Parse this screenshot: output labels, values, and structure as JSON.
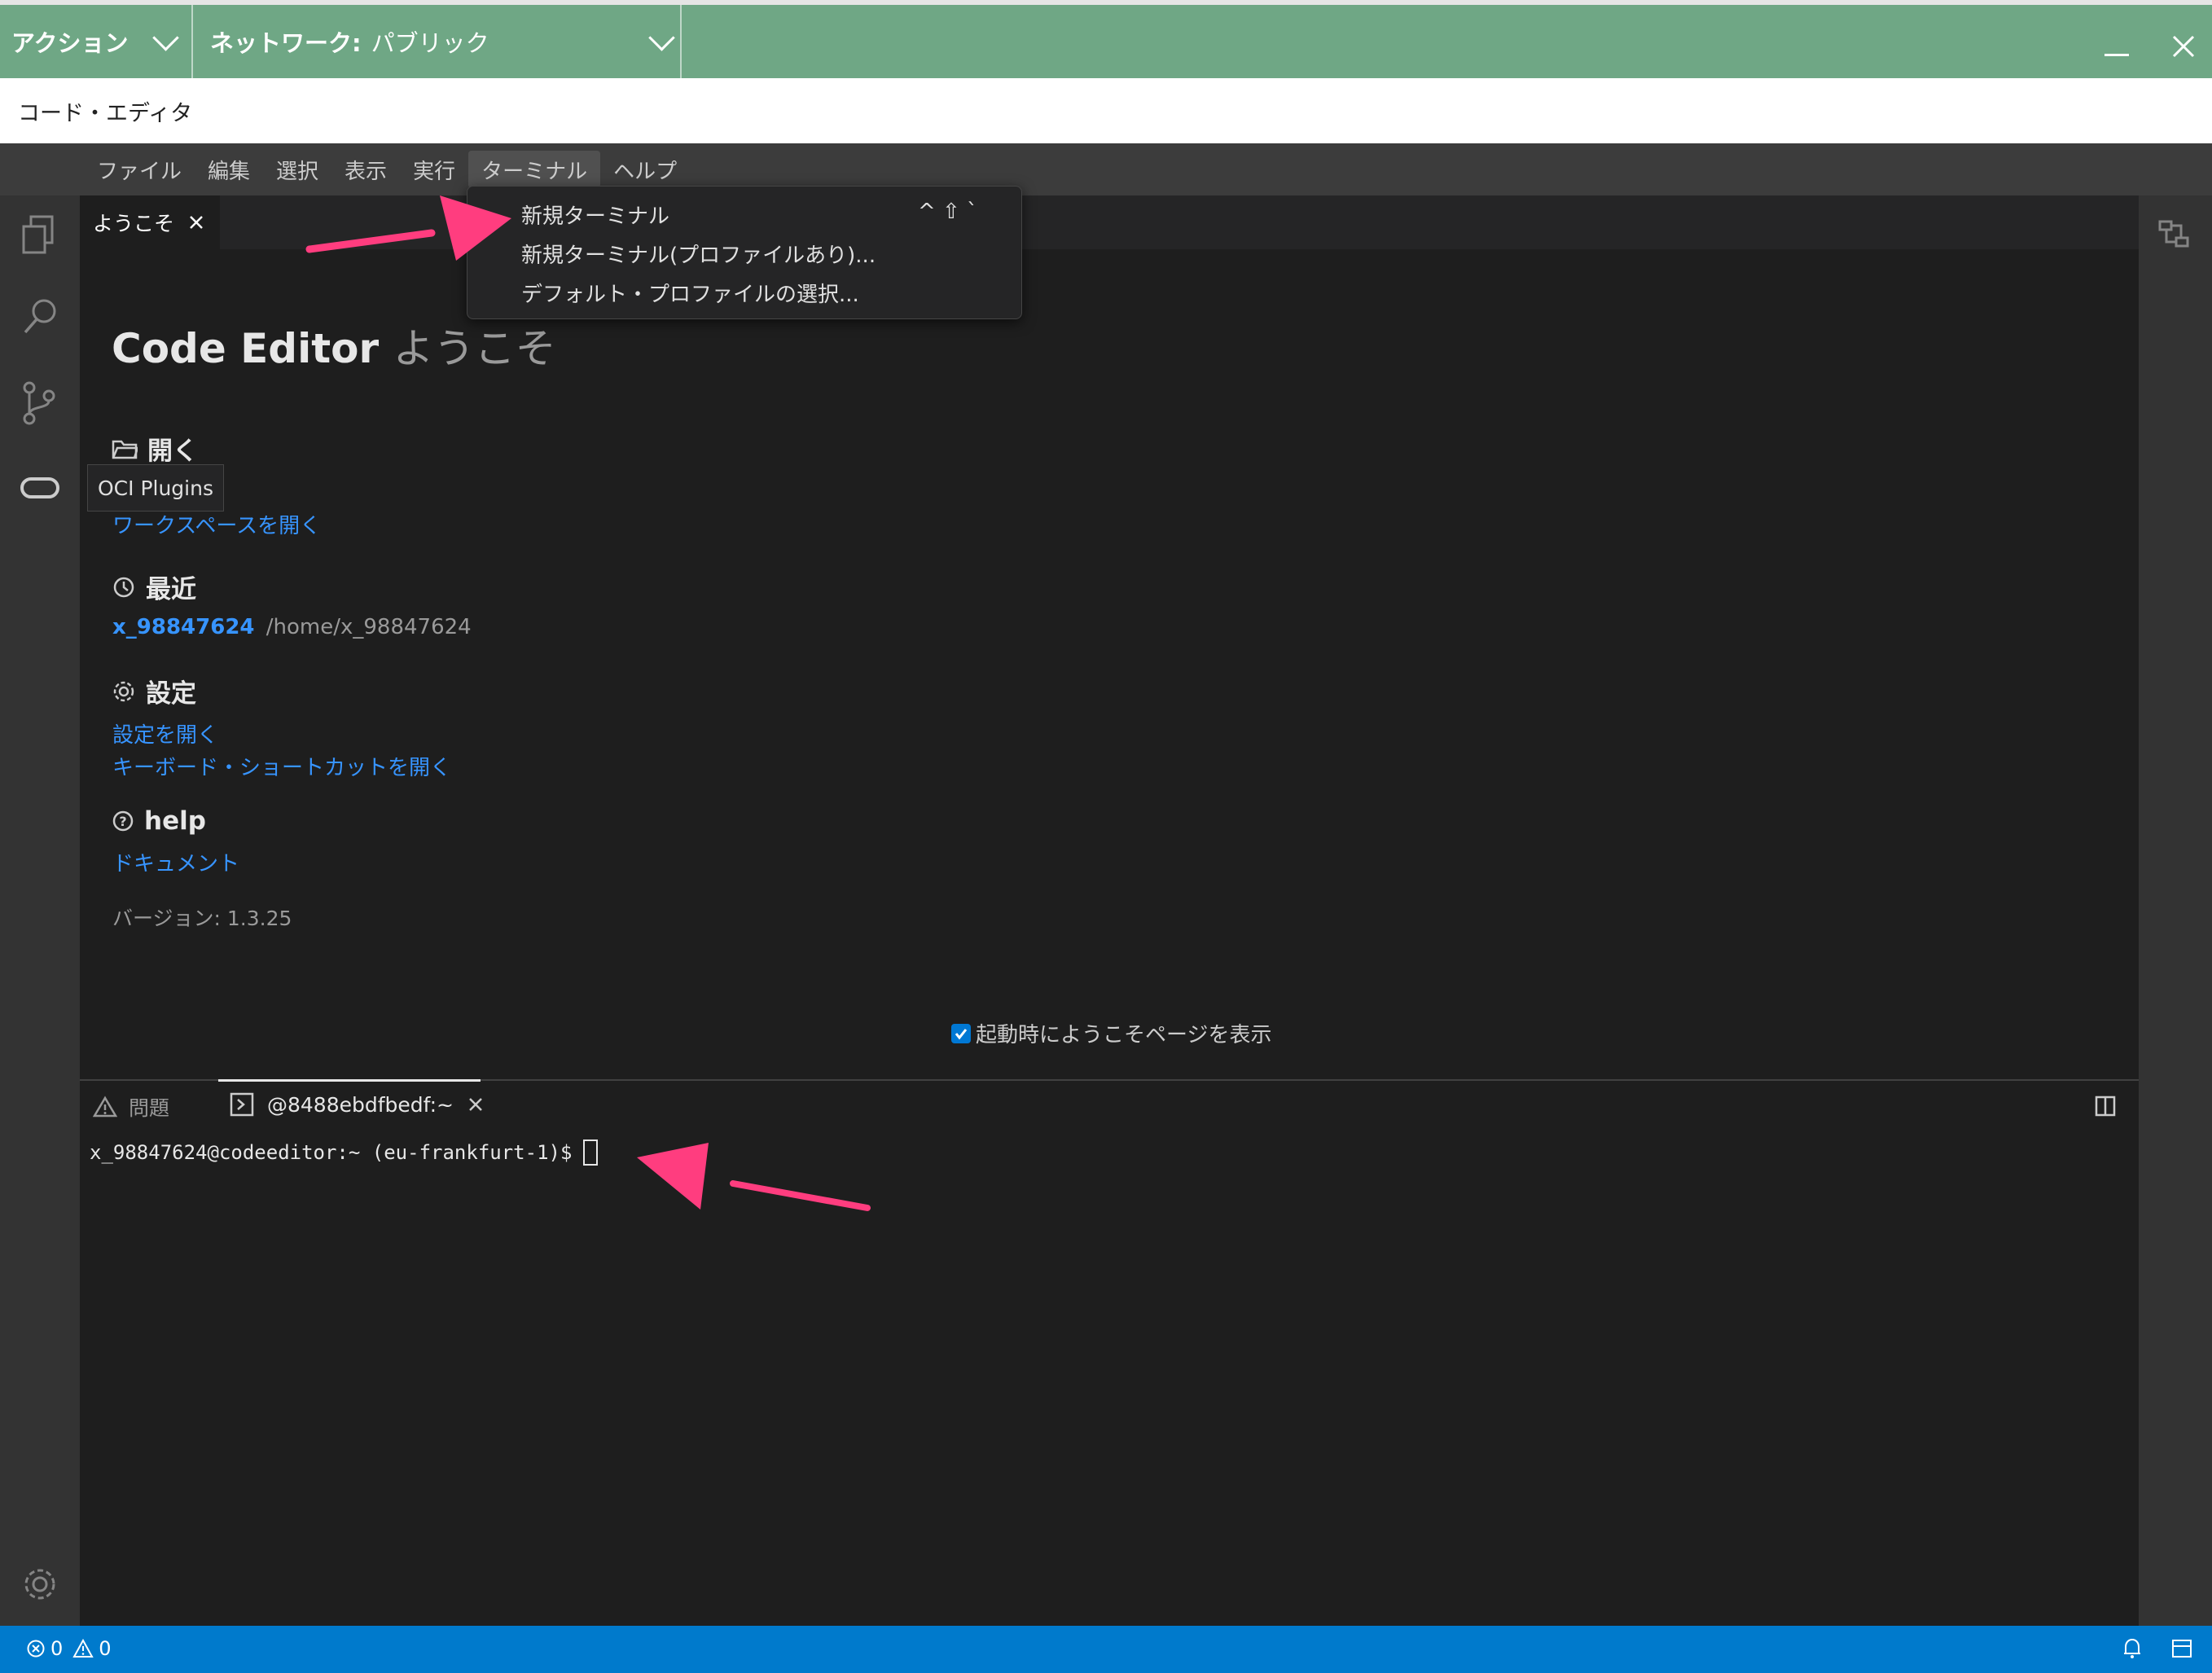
{
  "frame": {
    "action_label": "アクション",
    "network_label": "ネットワーク:",
    "network_value": "パブリック",
    "window_title": "コード・エディタ",
    "accent": "#6fa785"
  },
  "menubar": {
    "items": [
      "ファイル",
      "編集",
      "選択",
      "表示",
      "実行",
      "ターミナル",
      "ヘルプ"
    ]
  },
  "terminal_menu": {
    "items": [
      {
        "label": "新規ターミナル",
        "shortcut": "^ ⇧ `"
      },
      {
        "label": "新規ターミナル(プロファイルあり)..."
      },
      {
        "label": "デフォルト・プロファイルの選択..."
      }
    ]
  },
  "tabs": {
    "welcome_label": "ようこそ"
  },
  "tooltip": {
    "label": "OCI Plugins"
  },
  "welcome": {
    "title_main": "Code Editor",
    "title_sub": "ようこそ",
    "open_heading": "開く",
    "open_workspace": "ワークスペースを開く",
    "recent_heading": "最近",
    "recent_name": "x_98847624",
    "recent_path": "/home/x_98847624",
    "settings_heading": "設定",
    "settings_open": "設定を開く",
    "keyboard_shortcuts": "キーボード・ショートカットを開く",
    "help_heading": "help",
    "docs": "ドキュメント",
    "version": "バージョン: 1.3.25",
    "show_on_startup": "起動時にようこそページを表示",
    "show_on_startup_checked": true
  },
  "panel": {
    "problems_tab": "問題",
    "terminal_tab": "@8488ebdfbedf:~",
    "prompt": "x_98847624@codeeditor:~ (eu-frankfurt-1)$"
  },
  "status": {
    "errors": "0",
    "warnings": "0",
    "accent": "#007acc"
  },
  "annotation_color": "#ff3d7f"
}
